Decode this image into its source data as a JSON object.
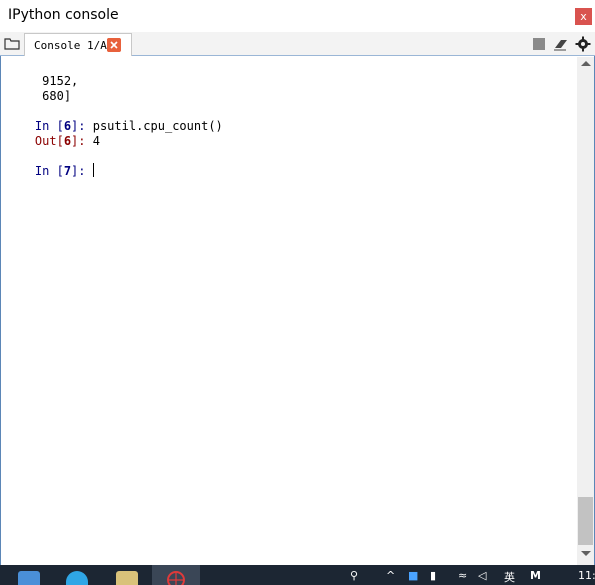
{
  "window": {
    "title": "IPython console",
    "close_glyph": "x"
  },
  "tabbar": {
    "tab_label": "Console 1/A",
    "icons": [
      "folder-icon",
      "tab-close-icon",
      "stop-icon",
      "eraser-icon",
      "gear-icon"
    ]
  },
  "console": {
    "lines": {
      "l1": "9152,",
      "l2": "680]",
      "in6_prefix": "In [",
      "in6_num": "6",
      "in6_suffix": "]: ",
      "in6_code": "psutil.cpu_count()",
      "out6_prefix": "Out[",
      "out6_num": "6",
      "out6_suffix": "]: ",
      "out6_value": "4",
      "in7_prefix": "In [",
      "in7_num": "7",
      "in7_suffix": "]: "
    }
  },
  "taskbar": {
    "tray_lang": "英",
    "tray_m": "M",
    "clock": "11:"
  },
  "colors": {
    "in_prompt": "#000080",
    "out_prompt": "#8b0000",
    "close_red": "#d9534f",
    "border_blue": "#5b86b7"
  }
}
